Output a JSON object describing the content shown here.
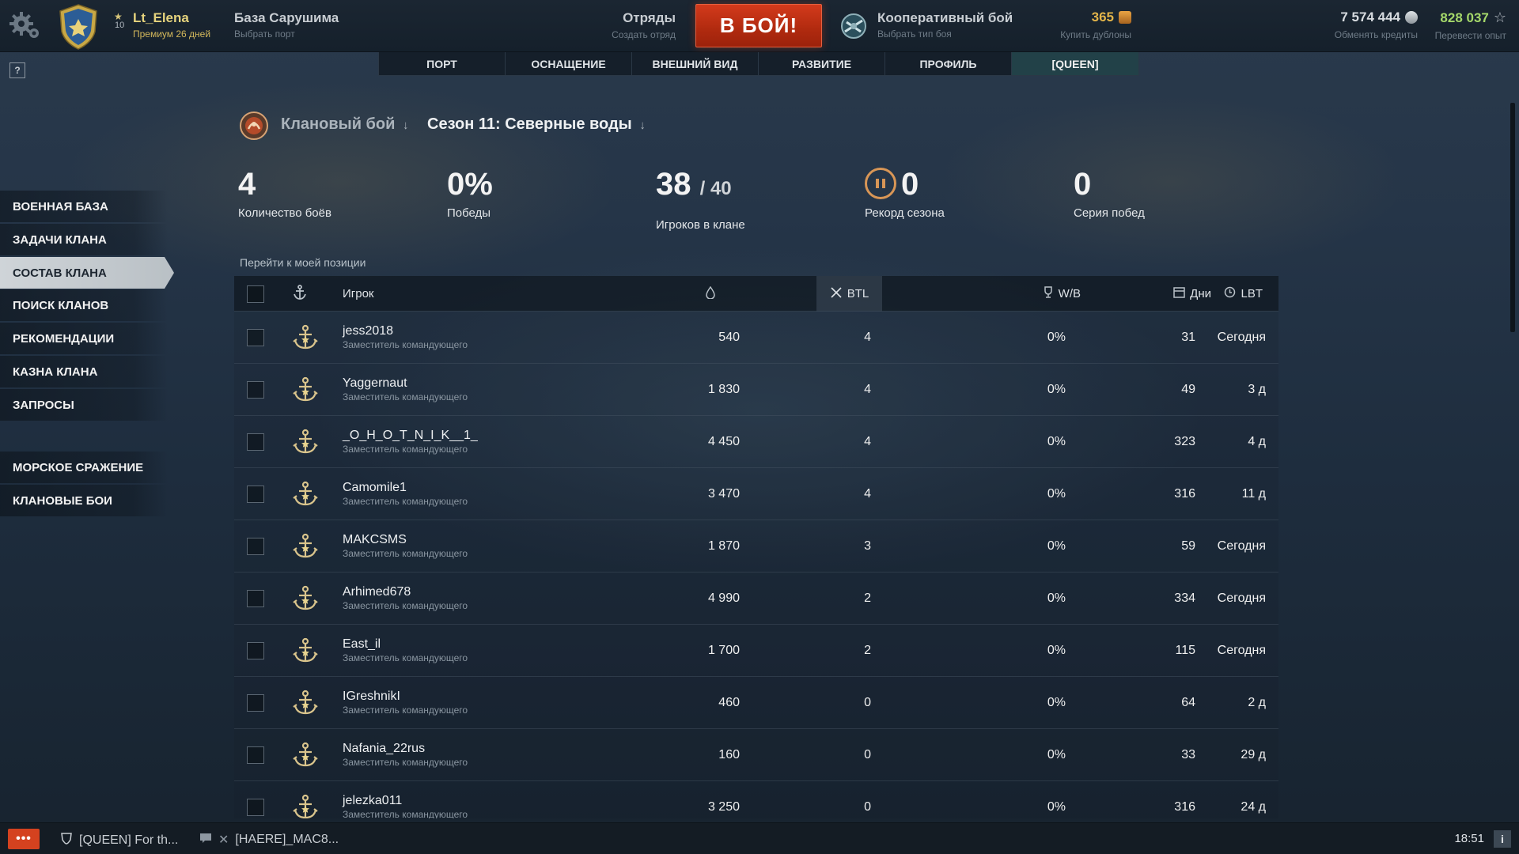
{
  "topbar": {
    "player_name": "Lt_Elena",
    "rank": "10",
    "premium": "Премиум 26 дней",
    "port_name": "База Сарушима",
    "port_sub": "Выбрать порт",
    "squads_title": "Отряды",
    "squads_sub": "Создать отряд",
    "battle_button": "В БОЙ!",
    "mode_title": "Кооперативный бой",
    "mode_sub": "Выбрать тип боя",
    "doubloons": "365",
    "doubloons_action": "Купить дублоны",
    "credits": "7 574 444",
    "credits_action": "Обменять кредиты",
    "free_xp": "828 037",
    "free_xp_action": "Перевести опыт"
  },
  "tabs": [
    {
      "label": "ПОРТ"
    },
    {
      "label": "ОСНАЩЕНИЕ"
    },
    {
      "label": "ВНЕШНИЙ ВИД"
    },
    {
      "label": "РАЗВИТИЕ"
    },
    {
      "label": "ПРОФИЛЬ"
    },
    {
      "label": "[QUEEN]",
      "active": true
    }
  ],
  "help_label": "?",
  "sidebar": {
    "items": [
      {
        "label": "ВОЕННАЯ БАЗА"
      },
      {
        "label": "ЗАДАЧИ КЛАНА"
      },
      {
        "label": "СОСТАВ КЛАНА",
        "active": true
      },
      {
        "label": "ПОИСК КЛАНОВ"
      },
      {
        "label": "РЕКОМЕНДАЦИИ"
      },
      {
        "label": "КАЗНА КЛАНА"
      },
      {
        "label": "ЗАПРОСЫ"
      },
      {
        "label": "МОРСКОЕ СРАЖЕНИЕ"
      },
      {
        "label": "КЛАНОВЫЕ БОИ"
      }
    ]
  },
  "header": {
    "mode": "Клановый бой",
    "season": "Сезон 11: Северные воды"
  },
  "stats": {
    "battles": {
      "value": "4",
      "label": "Количество боёв"
    },
    "wins": {
      "value": "0%",
      "label": "Победы"
    },
    "players": {
      "value": "38",
      "max": "/ 40",
      "label": "Игроков в клане"
    },
    "record": {
      "value": "0",
      "label": "Рекорд сезона"
    },
    "streak": {
      "value": "0",
      "label": "Серия побед"
    }
  },
  "goto_link": "Перейти к моей позиции",
  "table": {
    "columns": {
      "player": "Игрок",
      "battles": "BTL",
      "winrate": "W/B",
      "days": "Дни",
      "last_battle": "LBT"
    },
    "rows": [
      {
        "name": "jess2018",
        "role": "Заместитель командующего",
        "oil": "540",
        "btl": "4",
        "wb": "0%",
        "days": "31",
        "lbt": "Сегодня"
      },
      {
        "name": "Yaggernaut",
        "role": "Заместитель командующего",
        "oil": "1 830",
        "btl": "4",
        "wb": "0%",
        "days": "49",
        "lbt": "3 д"
      },
      {
        "name": "_O_H_O_T_N_I_K__1_",
        "role": "Заместитель командующего",
        "oil": "4 450",
        "btl": "4",
        "wb": "0%",
        "days": "323",
        "lbt": "4 д"
      },
      {
        "name": "Camomile1",
        "role": "Заместитель командующего",
        "oil": "3 470",
        "btl": "4",
        "wb": "0%",
        "days": "316",
        "lbt": "11 д"
      },
      {
        "name": "MAKCSMS",
        "role": "Заместитель командующего",
        "oil": "1 870",
        "btl": "3",
        "wb": "0%",
        "days": "59",
        "lbt": "Сегодня"
      },
      {
        "name": "Arhimed678",
        "role": "Заместитель командующего",
        "oil": "4 990",
        "btl": "2",
        "wb": "0%",
        "days": "334",
        "lbt": "Сегодня"
      },
      {
        "name": "East_il",
        "role": "Заместитель командующего",
        "oil": "1 700",
        "btl": "2",
        "wb": "0%",
        "days": "115",
        "lbt": "Сегодня"
      },
      {
        "name": "IGreshnikI",
        "role": "Заместитель командующего",
        "oil": "460",
        "btl": "0",
        "wb": "0%",
        "days": "64",
        "lbt": "2 д"
      },
      {
        "name": "Nafania_22rus",
        "role": "Заместитель командующего",
        "oil": "160",
        "btl": "0",
        "wb": "0%",
        "days": "33",
        "lbt": "29 д"
      },
      {
        "name": "jelezka011",
        "role": "Заместитель командующего",
        "oil": "3 250",
        "btl": "0",
        "wb": "0%",
        "days": "316",
        "lbt": "24 д"
      }
    ]
  },
  "bottombar": {
    "chat_button": "•••",
    "chat_tab_1": "[QUEEN] For th...",
    "chat_tab_2": "[HAERE]_MAC8...",
    "time": "18:51",
    "info": "i"
  },
  "colors": {
    "battle_button": "#c0321a",
    "premium": "#d2b75b",
    "doubloons": "#e4b54a",
    "free_xp": "#a5d86a",
    "record_ring": "#d89656"
  }
}
